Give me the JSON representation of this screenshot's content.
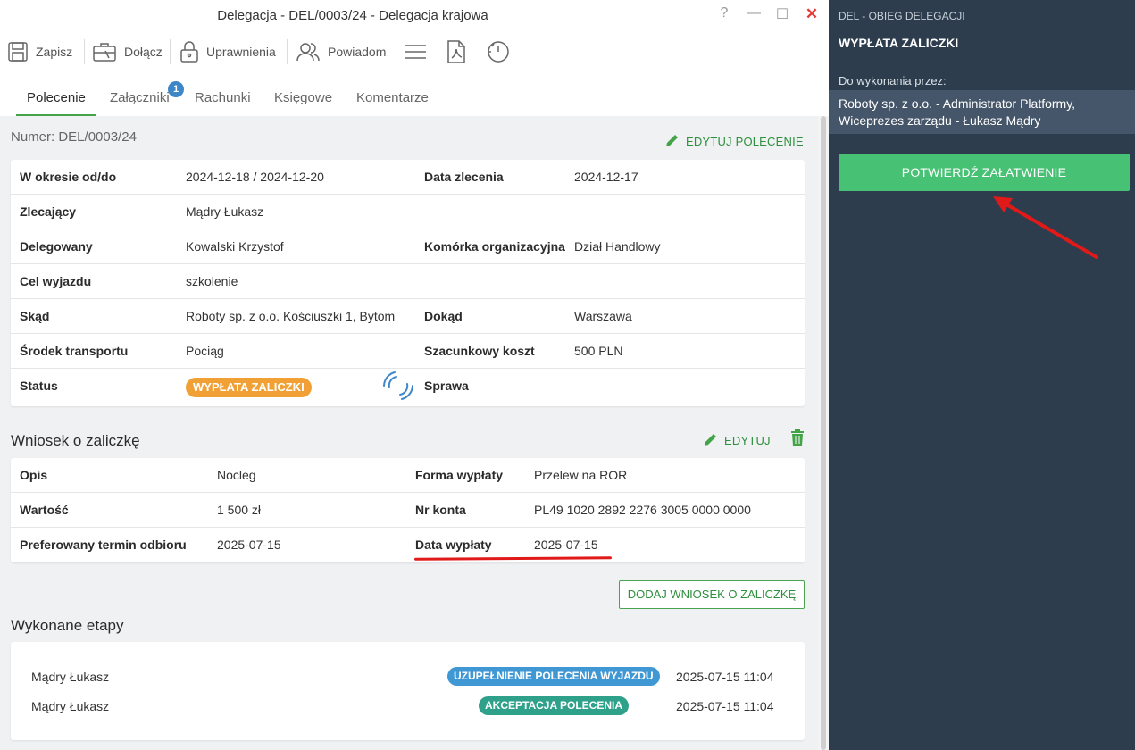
{
  "window": {
    "title": "Delegacja - DEL/0003/24 - Delegacja krajowa",
    "controls": {
      "help": "?",
      "minimize": "—",
      "maximize": "☐",
      "close": "✕"
    }
  },
  "toolbar": {
    "save_label": "Zapisz",
    "attach_label": "Dołącz",
    "permissions_label": "Uprawnienia",
    "notify_label": "Powiadom",
    "icons": [
      "save-icon",
      "briefcase-icon",
      "lock-icon",
      "users-icon",
      "menu-icon",
      "pdf-icon",
      "history-icon"
    ]
  },
  "tabs": [
    {
      "label": "Polecenie",
      "active": true
    },
    {
      "label": "Załączniki",
      "badge": "1"
    },
    {
      "label": "Rachunki"
    },
    {
      "label": "Księgowe"
    },
    {
      "label": "Komentarze"
    }
  ],
  "order": {
    "number": "Numer: DEL/0003/24",
    "edit_label": "EDYTUJ POLECENIE",
    "rows": [
      {
        "l1": "W okresie od/do",
        "v1": "2024-12-18 / 2024-12-20",
        "l2": "Data zlecenia",
        "v2": "2024-12-17"
      },
      {
        "l1": "Zlecający",
        "v1": "Mądry Łukasz",
        "l2": "",
        "v2": ""
      },
      {
        "l1": "Delegowany",
        "v1": "Kowalski Krzystof",
        "l2": "Komórka organizacyjna",
        "v2": "Dział Handlowy"
      },
      {
        "l1": "Cel wyjazdu",
        "v1": "szkolenie",
        "l2": "",
        "v2": ""
      },
      {
        "l1": "Skąd",
        "v1": "Roboty sp. z o.o. Kościuszki 1, Bytom",
        "l2": "Dokąd",
        "v2": "Warszawa"
      },
      {
        "l1": "Środek transportu",
        "v1": "Pociąg",
        "l2": "Szacunkowy koszt",
        "v2": "500 PLN"
      },
      {
        "l1": "Status",
        "v1": "WYPŁATA ZALICZKI",
        "l2": "Sprawa",
        "v2": ""
      }
    ],
    "status_color": "#f0a035"
  },
  "advance": {
    "title": "Wniosek o zaliczkę",
    "edit_label": "EDYTUJ",
    "rows": [
      {
        "l1": "Opis",
        "v1": "Nocleg",
        "l2": "Forma wypłaty",
        "v2": "Przelew na ROR"
      },
      {
        "l1": "Wartość",
        "v1": "1 500 zł",
        "l2": "Nr konta",
        "v2": "PL49 1020 2892 2276 3005 0000 0000"
      },
      {
        "l1": "Preferowany termin odbioru",
        "v1": "2025-07-15",
        "l2": "Data wypłaty",
        "v2": "2025-07-15"
      }
    ],
    "add_button": "DODAJ WNIOSEK O ZALICZKĘ"
  },
  "stages": {
    "title": "Wykonane etapy",
    "items": [
      {
        "person": "Mądry Łukasz",
        "stage": "UZUPEŁNIENIE POLECENIA WYJAZDU",
        "color": "#3f97d4",
        "time": "2025-07-15 11:04"
      },
      {
        "person": "Mądry Łukasz",
        "stage": "AKCEPTACJA POLECENIA",
        "color": "#2fa08a",
        "time": "2025-07-15 11:04"
      }
    ]
  },
  "panel": {
    "subtitle": "DEL - OBIEG DELEGACJI",
    "title": "WYPŁATA ZALICZKI",
    "assignee_label": "Do wykonania przez:",
    "assignee": "Roboty sp. z o.o. - Administrator Platformy, Wiceprezes zarządu - Łukasz Mądry",
    "confirm_button": "POTWIERDŹ ZAŁATWIENIE",
    "bg_color": "#2d3d4d",
    "button_color": "#47c274"
  },
  "colors": {
    "accent_green": "#43a447",
    "annotation_red": "#e01919"
  }
}
